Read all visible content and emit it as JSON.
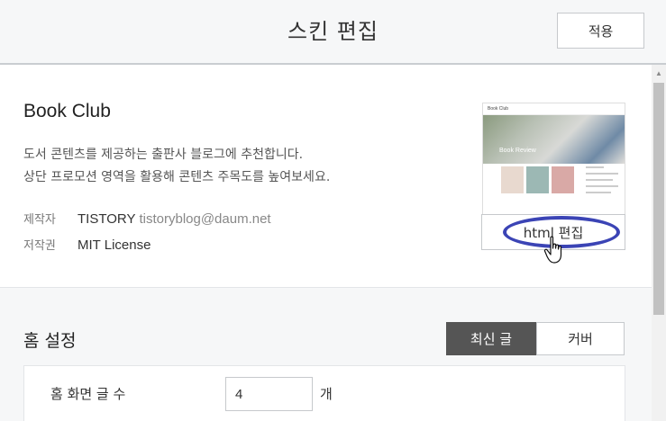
{
  "header": {
    "title": "스킨 편집",
    "apply_label": "적용"
  },
  "skin": {
    "name": "Book Club",
    "description_line1": "도서 콘텐츠를 제공하는 출판사 블로그에 추천합니다.",
    "description_line2": "상단 프로모션 영역을 활용해 콘텐츠 주목도를 높여보세요.",
    "author_label": "제작자",
    "author_name": "TISTORY",
    "author_email": "tistoryblog@daum.net",
    "license_label": "저작권",
    "license_value": "MIT License",
    "thumbnail": {
      "logo_text": "Book Club",
      "hero_text": "Book Review"
    },
    "html_edit_label": "html 편집"
  },
  "home_settings": {
    "title": "홈 설정",
    "tabs": [
      {
        "label": "최신 글",
        "active": true
      },
      {
        "label": "커버",
        "active": false
      }
    ],
    "post_count_label": "홈 화면 글 수",
    "post_count_value": "4",
    "post_count_unit": "개"
  },
  "colors": {
    "highlight_oval": "#3b44b5",
    "active_tab_bg": "#555555"
  }
}
